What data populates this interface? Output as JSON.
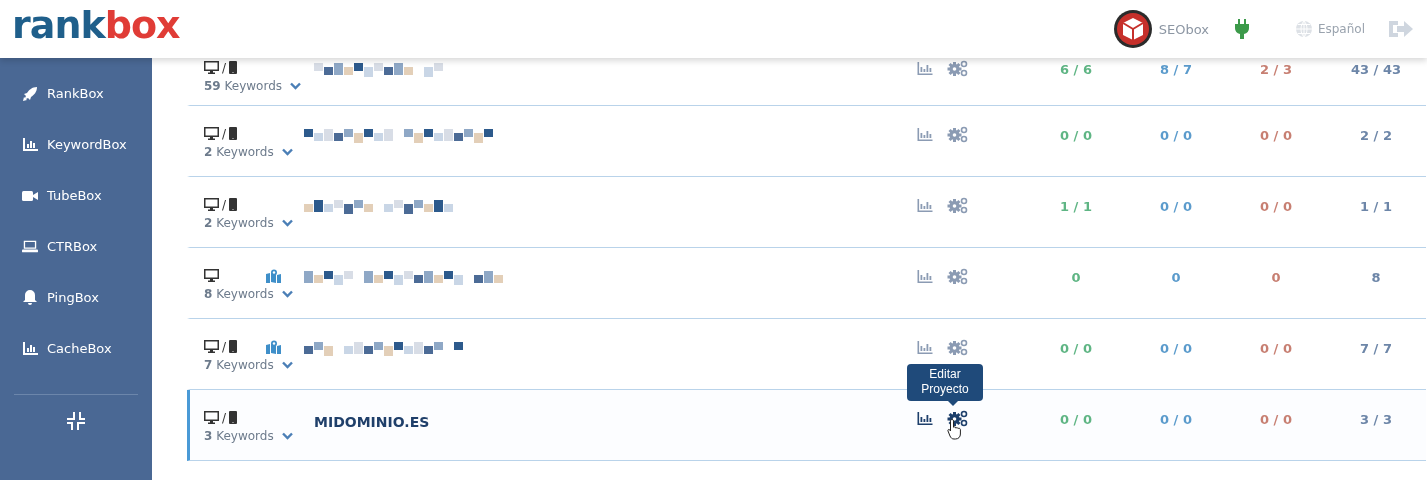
{
  "header": {
    "logo": {
      "left": "rank",
      "right": "box"
    },
    "account": "SEObox",
    "language": "Español"
  },
  "sidebar": {
    "items": [
      {
        "label": "RankBox"
      },
      {
        "label": "KeywordBox"
      },
      {
        "label": "TubeBox"
      },
      {
        "label": "CTRBox"
      },
      {
        "label": "PingBox"
      },
      {
        "label": "CacheBox"
      }
    ]
  },
  "projects": [
    {
      "desktop": true,
      "separator": "/",
      "mobile": true,
      "local": false,
      "keywords": "**59** Keywords",
      "domain": {
        "kind": "blurred"
      },
      "selected": false,
      "stats": [
        "6 / 6",
        "8 / 7",
        "2 / 3",
        "43 / 43"
      ]
    },
    {
      "desktop": true,
      "separator": "/",
      "mobile": true,
      "local": false,
      "keywords": "**2** Keywords",
      "domain": {
        "kind": "blurred"
      },
      "selected": false,
      "stats": [
        "0 / 0",
        "0 / 0",
        "0 / 0",
        "2 / 2"
      ]
    },
    {
      "desktop": true,
      "separator": "/",
      "mobile": true,
      "local": false,
      "keywords": "**2** Keywords",
      "domain": {
        "kind": "blurred"
      },
      "selected": false,
      "stats": [
        "1 / 1",
        "0 / 0",
        "0 / 0",
        "1 / 1"
      ]
    },
    {
      "desktop": true,
      "mobile": false,
      "local": true,
      "keywords": "**8** Keywords",
      "domain": {
        "kind": "blurred"
      },
      "selected": false,
      "stats": [
        "0",
        "0",
        "0",
        "8"
      ]
    },
    {
      "desktop": true,
      "separator": "/",
      "mobile": true,
      "local": true,
      "keywords": "**7** Keywords",
      "domain": {
        "kind": "blurred"
      },
      "selected": false,
      "stats": [
        "0 / 0",
        "0 / 0",
        "0 / 0",
        "7 / 7"
      ]
    },
    {
      "desktop": true,
      "separator": "/",
      "mobile": true,
      "local": false,
      "keywords": "**3** Keywords",
      "domain": {
        "kind": "text",
        "text": "MIDOMINIO.ES"
      },
      "selected": true,
      "stats": [
        "0 / 0",
        "0 / 0",
        "0 / 0",
        "3 / 3"
      ],
      "tooltip": "Editar Proyecto"
    }
  ]
}
